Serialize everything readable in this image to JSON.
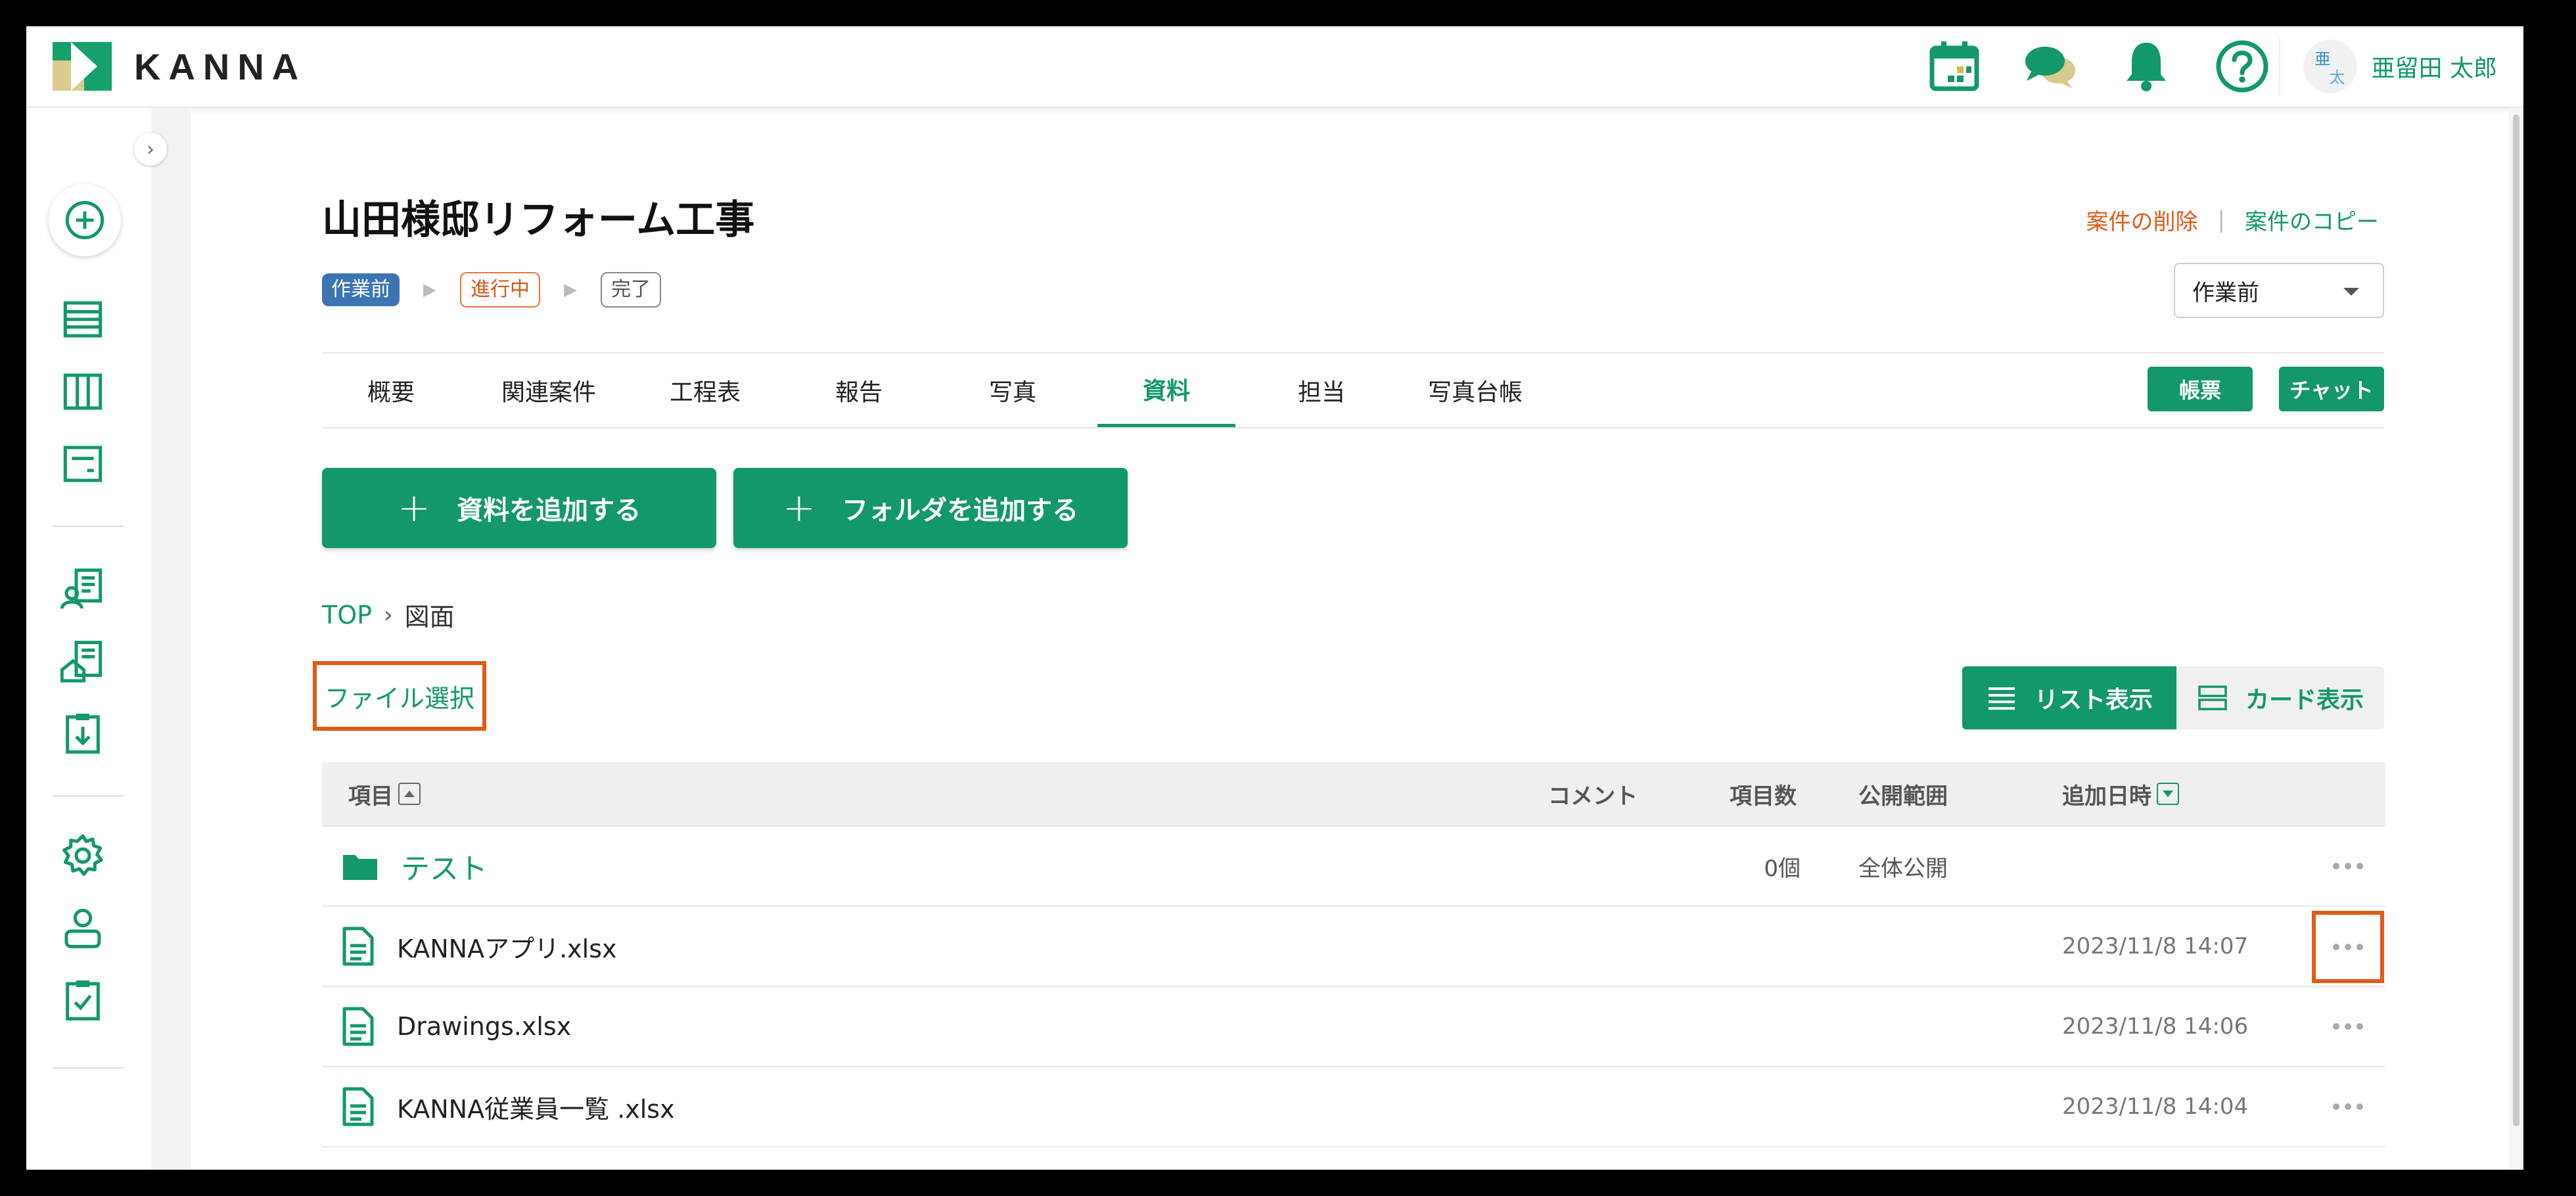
{
  "app": {
    "logo_text": "KANNA",
    "brand_color": "#12986a"
  },
  "header": {
    "icons": [
      "calendar-icon",
      "chat-icon",
      "bell-icon",
      "help-icon"
    ],
    "user": {
      "avatar_text_1": "亜",
      "avatar_text_2": "太",
      "name": "亜留田 太郎"
    }
  },
  "sidebar": {
    "collapse_label": "›",
    "items": [
      "add-icon",
      "list-view-icon",
      "board-view-icon",
      "document-icon",
      "customer-icon",
      "property-icon",
      "download-report-icon",
      "settings-icon",
      "user-icon",
      "checklist-icon"
    ]
  },
  "project": {
    "title": "山田様邸リフォーム工事",
    "delete_label": "案件の削除",
    "separator": "|",
    "copy_label": "案件のコピー",
    "status_steps": [
      "作業前",
      "進行中",
      "完了"
    ],
    "status_arrow": "▶",
    "status_select_value": "作業前"
  },
  "tabs": [
    {
      "label": "概要"
    },
    {
      "label": "関連案件"
    },
    {
      "label": "工程表"
    },
    {
      "label": "報告"
    },
    {
      "label": "写真"
    },
    {
      "label": "資料",
      "active": true
    },
    {
      "label": "担当"
    },
    {
      "label": "写真台帳"
    }
  ],
  "tab_buttons": {
    "report": "帳票",
    "chat": "チャット"
  },
  "actions": {
    "plus": "+",
    "add_file": "資料を追加する",
    "add_folder": "フォルダを追加する"
  },
  "breadcrumb": {
    "root": "TOP",
    "chevron": "›",
    "current": "図面"
  },
  "file_select_label": "ファイル選択",
  "view_toggle": {
    "list": "リスト表示",
    "card": "カード表示"
  },
  "table": {
    "columns": {
      "item": "項目",
      "comment": "コメント",
      "count": "項目数",
      "scope": "公開範囲",
      "added": "追加日時"
    },
    "rows": [
      {
        "type": "folder",
        "name": "テスト",
        "count": "0個",
        "scope": "全体公開",
        "date": ""
      },
      {
        "type": "file",
        "name": "KANNAアプリ.xlsx",
        "count": "",
        "scope": "",
        "date": "2023/11/8 14:07",
        "highlight": true
      },
      {
        "type": "file",
        "name": "Drawings.xlsx",
        "count": "",
        "scope": "",
        "date": "2023/11/8 14:06"
      },
      {
        "type": "file",
        "name": "KANNA従業員一覧 .xlsx",
        "count": "",
        "scope": "",
        "date": "2023/11/8 14:04"
      }
    ]
  },
  "highlight_color": "#e25b16"
}
